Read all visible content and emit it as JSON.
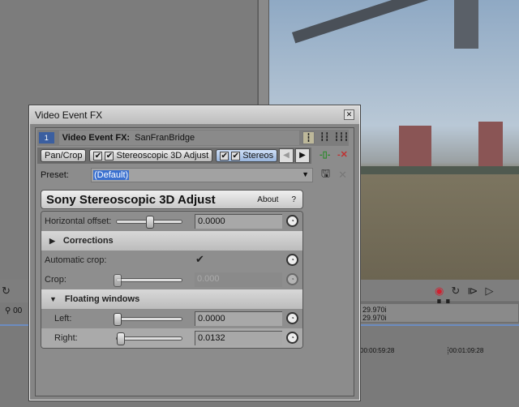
{
  "dialog": {
    "title": "Video Event FX",
    "close_icon": "close-icon"
  },
  "fx_header": {
    "track_badge": "1",
    "label": "Video Event FX:",
    "event_name": "SanFranBridge"
  },
  "chain": {
    "items": [
      {
        "label": "Pan/Crop",
        "checked": false
      },
      {
        "label": "Stereoscopic 3D Adjust",
        "checked": true
      },
      {
        "label": "Stereos",
        "checked": true,
        "selected": true
      }
    ]
  },
  "preset": {
    "label": "Preset:",
    "value": "(Default)"
  },
  "plugin": {
    "title": "Sony Stereoscopic 3D Adjust",
    "about": "About",
    "help": "?",
    "horizontal_offset": {
      "label": "Horizontal offset:",
      "value": "0.0000",
      "slider": 0.5
    },
    "corrections": {
      "label": "Corrections",
      "expanded": false
    },
    "automatic_crop": {
      "label": "Automatic crop:",
      "checked": true
    },
    "crop": {
      "label": "Crop:",
      "value": "0.000",
      "slider": 0,
      "disabled": true
    },
    "floating_windows": {
      "label": "Floating windows",
      "expanded": true
    },
    "left": {
      "label": "Left:",
      "value": "0.0000",
      "slider": 0
    },
    "right": {
      "label": "Right:",
      "value": "0.0132",
      "slider": 0.05
    }
  },
  "status": {
    "rate1": "29.970i",
    "rate2": "29.970i",
    "left_time": "00",
    "left_ruler": "29"
  },
  "ruler": {
    "t1": "00:00:59:28",
    "t2": "00:01:09:28"
  },
  "colors": {
    "accent": "#3a70d0",
    "record": "#d02030"
  }
}
